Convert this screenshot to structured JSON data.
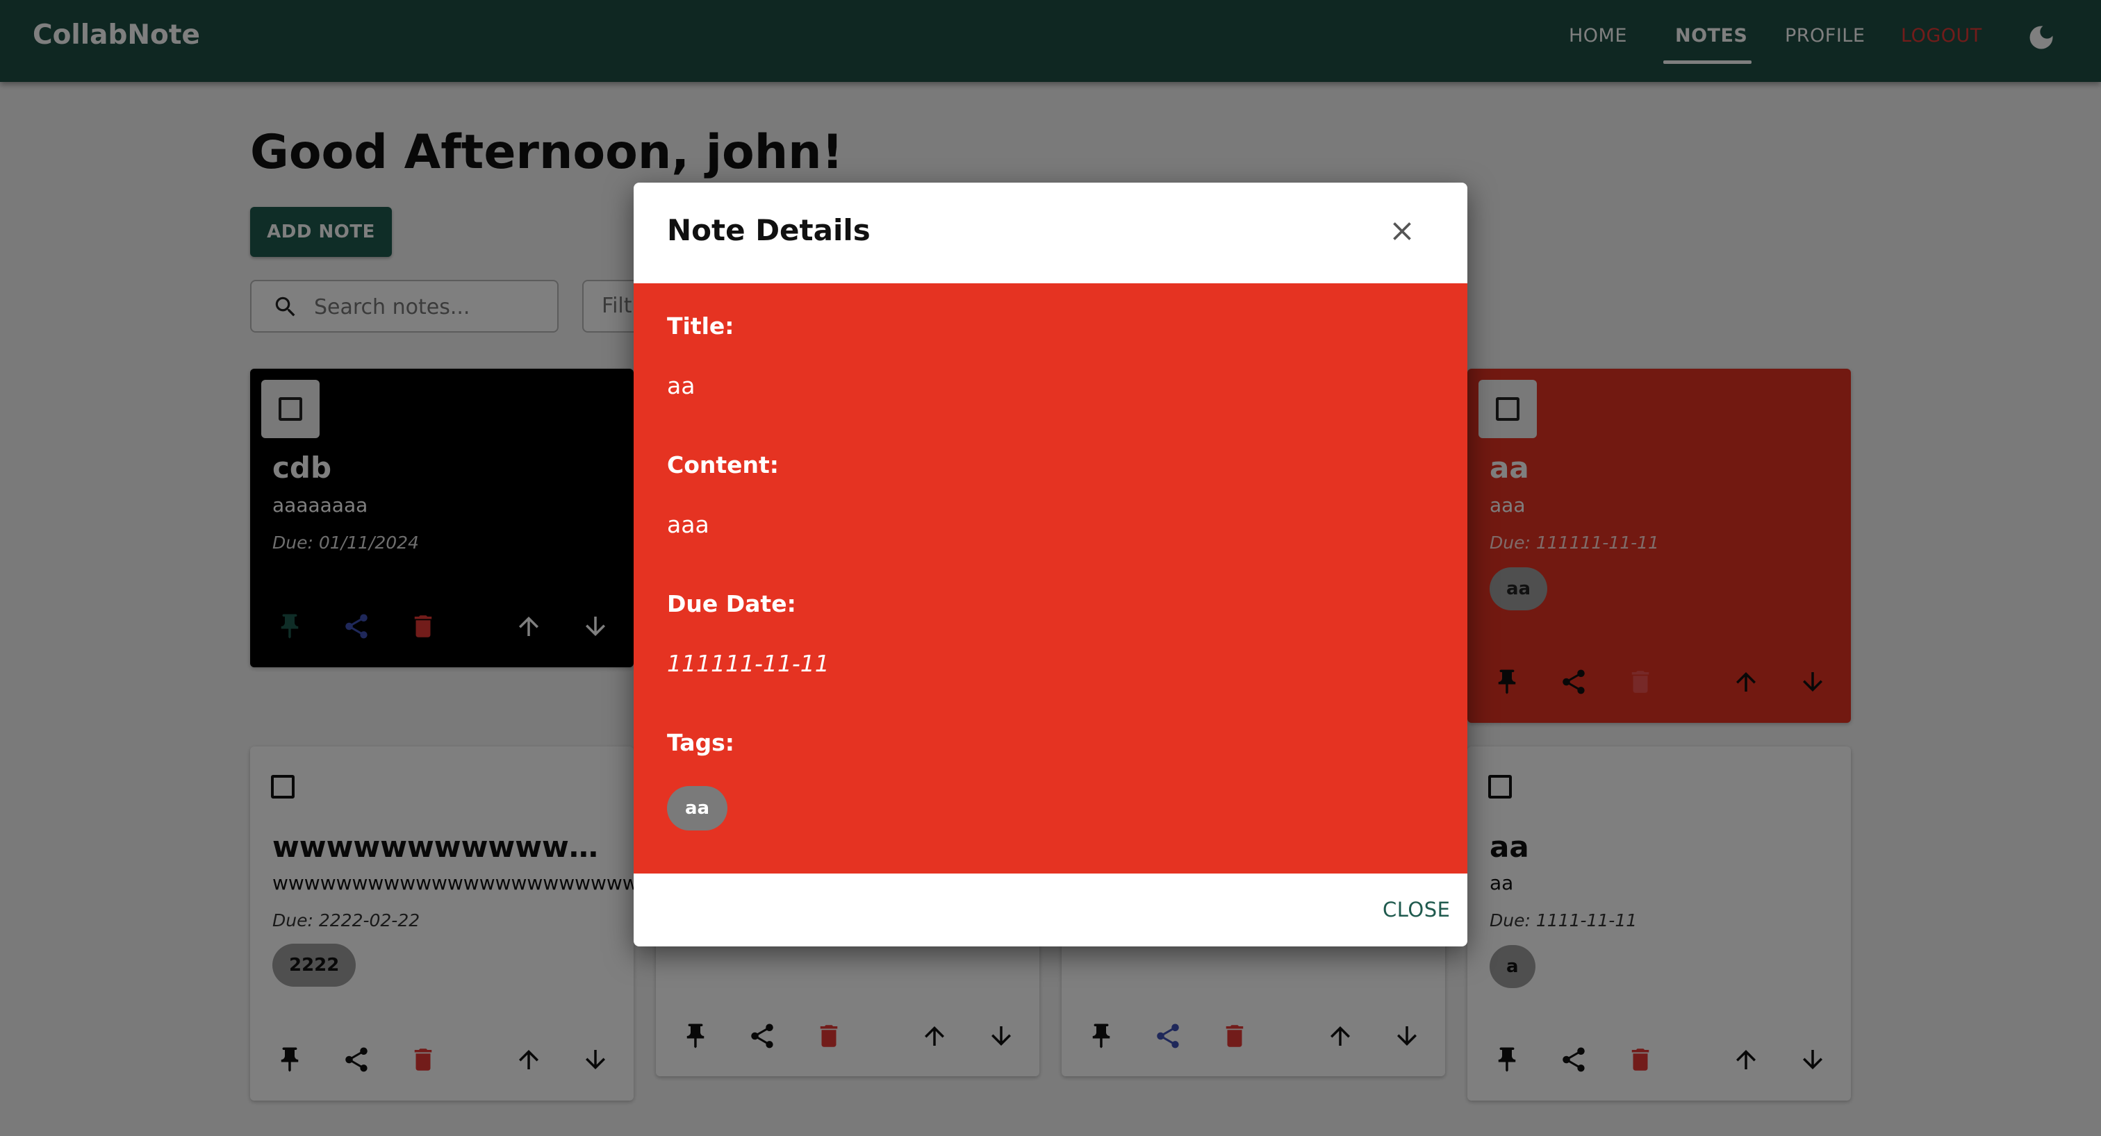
{
  "app": {
    "brand": "CollabNote",
    "nav": {
      "home": "HOME",
      "notes": "NOTES",
      "profile": "PROFILE",
      "logout": "LOGOUT"
    },
    "theme_toggle_icon": "moon-icon"
  },
  "page": {
    "greeting": "Good Afternoon, john!",
    "add_note_label": "ADD NOTE",
    "search_placeholder": "Search notes...",
    "filter_label": "Filt"
  },
  "cards": [
    {
      "title": "cdb",
      "content": "aaaaaaaa",
      "due": "Due: 01/11/2024",
      "color": "#000000"
    },
    {
      "title": "aa",
      "content": "aaa",
      "due": "Due: 111111-11-11",
      "tag": "aa",
      "color": "#e53322"
    },
    {
      "title": "wwwwwwwwwwwwww...",
      "content": "wwwwwwwwwwwwwwwwwwwwwwwwww",
      "due": "Due: 2222-02-22",
      "tag": "2222",
      "color": "#ffffff"
    },
    {
      "title": "aa",
      "content": "aa",
      "due": "Due: 1111-11-11",
      "tag": "a",
      "color": "#ffffff"
    }
  ],
  "modal": {
    "title": "Note Details",
    "close_icon": "close-icon",
    "title_label": "Title:",
    "title_value": "aa",
    "content_label": "Content:",
    "content_value": "aaa",
    "due_label": "Due Date:",
    "due_value": "111111-11-11",
    "tags_label": "Tags:",
    "tags": [
      "aa"
    ],
    "close_button": "CLOSE",
    "body_color": "#e53322"
  },
  "colors": {
    "appbar": "#1f4e45",
    "primary": "#1f5a4e",
    "danger": "#e53935",
    "share_blue": "#3f51b5",
    "pin_green": "#1f5a4e"
  }
}
